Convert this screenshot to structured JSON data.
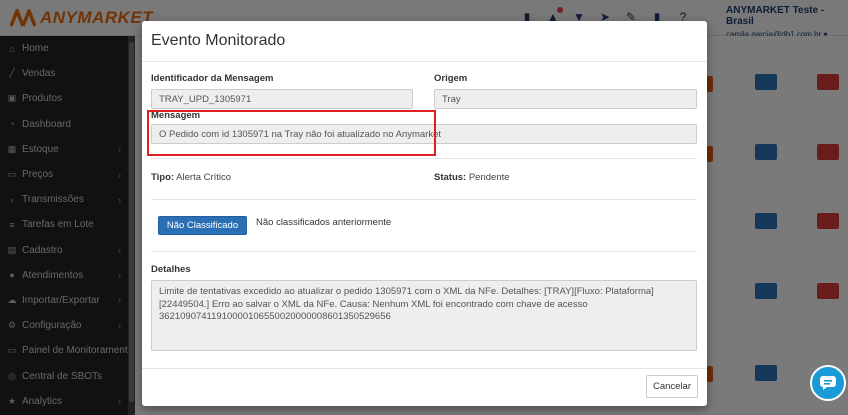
{
  "app": {
    "logo_text": "ANYMARKET",
    "brand_color": "#e2680f",
    "account_name": "ANYMARKET Teste - Brasil",
    "account_email": "camila.garcia@db1.com.br ▾"
  },
  "sidebar": {
    "items": [
      {
        "label": "Home",
        "icon": "home-icon",
        "chevron": false
      },
      {
        "label": "Vendas",
        "icon": "chart-icon",
        "chevron": false
      },
      {
        "label": "Produtos",
        "icon": "box-icon",
        "chevron": false
      },
      {
        "label": "Dashboard",
        "icon": "dashboard-icon",
        "chevron": false
      },
      {
        "label": "Estoque",
        "icon": "cubes-icon",
        "chevron": true
      },
      {
        "label": "Preços",
        "icon": "money-icon",
        "chevron": true
      },
      {
        "label": "Transmissões",
        "icon": "share-icon",
        "chevron": true
      },
      {
        "label": "Tarefas em Lote",
        "icon": "list-icon",
        "chevron": false
      },
      {
        "label": "Cadastro",
        "icon": "table-icon",
        "chevron": true
      },
      {
        "label": "Atendimentos",
        "icon": "comments-icon",
        "chevron": true
      },
      {
        "label": "Importar/Exportar",
        "icon": "cloud-icon",
        "chevron": true
      },
      {
        "label": "Configuração",
        "icon": "gear-icon",
        "chevron": true
      },
      {
        "label": "Painel de Monitoramento",
        "icon": "desktop-icon",
        "chevron": false
      },
      {
        "label": "Central de SBOTs",
        "icon": "robot-icon",
        "chevron": false
      },
      {
        "label": "Analytics",
        "icon": "star-icon",
        "chevron": true
      }
    ]
  },
  "modal": {
    "title": "Evento Monitorado",
    "id_label": "Identificador da Mensagem",
    "id_value": "TRAY_UPD_1305971",
    "origem_label": "Origem",
    "origem_value": "Tray",
    "mensagem_label": "Mensagem",
    "mensagem_value": "O Pedido com id 1305971 na Tray não foi atualizado no Anymarket",
    "tipo_label": "Tipo:",
    "tipo_value": "Alerta Crítico",
    "status_label": "Status:",
    "status_value": "Pendente",
    "classify_button": "Não Classificado",
    "classify_text": "Não classificados anteriormente",
    "detalhes_label": "Detalhes",
    "detalhes_value": "Limite de tentativas excedido ao atualizar o pedido 1305971 com o XML da NFe. Detalhes: [TRAY][Fluxo: Plataforma][22449504.] Erro ao salvar o XML da NFe. Causa: Nenhum XML foi encontrado com chave de acesso 36210907411910000106550020000008601350529656",
    "cancel_button": "Cancelar"
  },
  "colors": {
    "primary": "#2a6fb4",
    "danger": "#d23a3a",
    "highlight": "#e02020",
    "chat": "#1a9ad6"
  }
}
